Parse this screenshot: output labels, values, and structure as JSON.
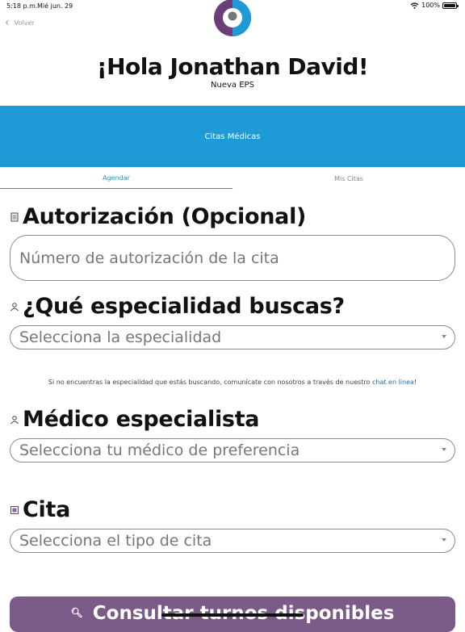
{
  "status": {
    "time": "5:18 p.m.",
    "date": "Mié jun. 29",
    "battery": "100%"
  },
  "nav": {
    "back_label": "Volver"
  },
  "header": {
    "greeting": "¡Hola Jonathan David!",
    "eps": "Nueva EPS"
  },
  "banner": {
    "title": "Citas Médicas"
  },
  "tabs": [
    {
      "label": "Agendar",
      "active": true
    },
    {
      "label": "Mis Citas",
      "active": false
    }
  ],
  "form": {
    "autorizacion": {
      "title": "Autorización (Opcional)",
      "placeholder": "Número de autorización de la cita"
    },
    "especialidad": {
      "title": "¿Qué especialidad buscas?",
      "placeholder": "Selecciona la especialidad"
    },
    "note": {
      "text": "Si no encuentras la especialidad que estás buscando, comunícate con nosotros a través de nuestro ",
      "link": "chat en línea",
      "suffix": "!"
    },
    "medico": {
      "title": "Médico especialista",
      "placeholder": "Selecciona tu médico de preferencia"
    },
    "cita": {
      "title": "Cita",
      "placeholder": "Selecciona el tipo de cita"
    }
  },
  "cta": {
    "label": "Consultar turnos disponibles"
  },
  "colors": {
    "accent": "#1e9ad6",
    "button": "#7a5a86"
  }
}
